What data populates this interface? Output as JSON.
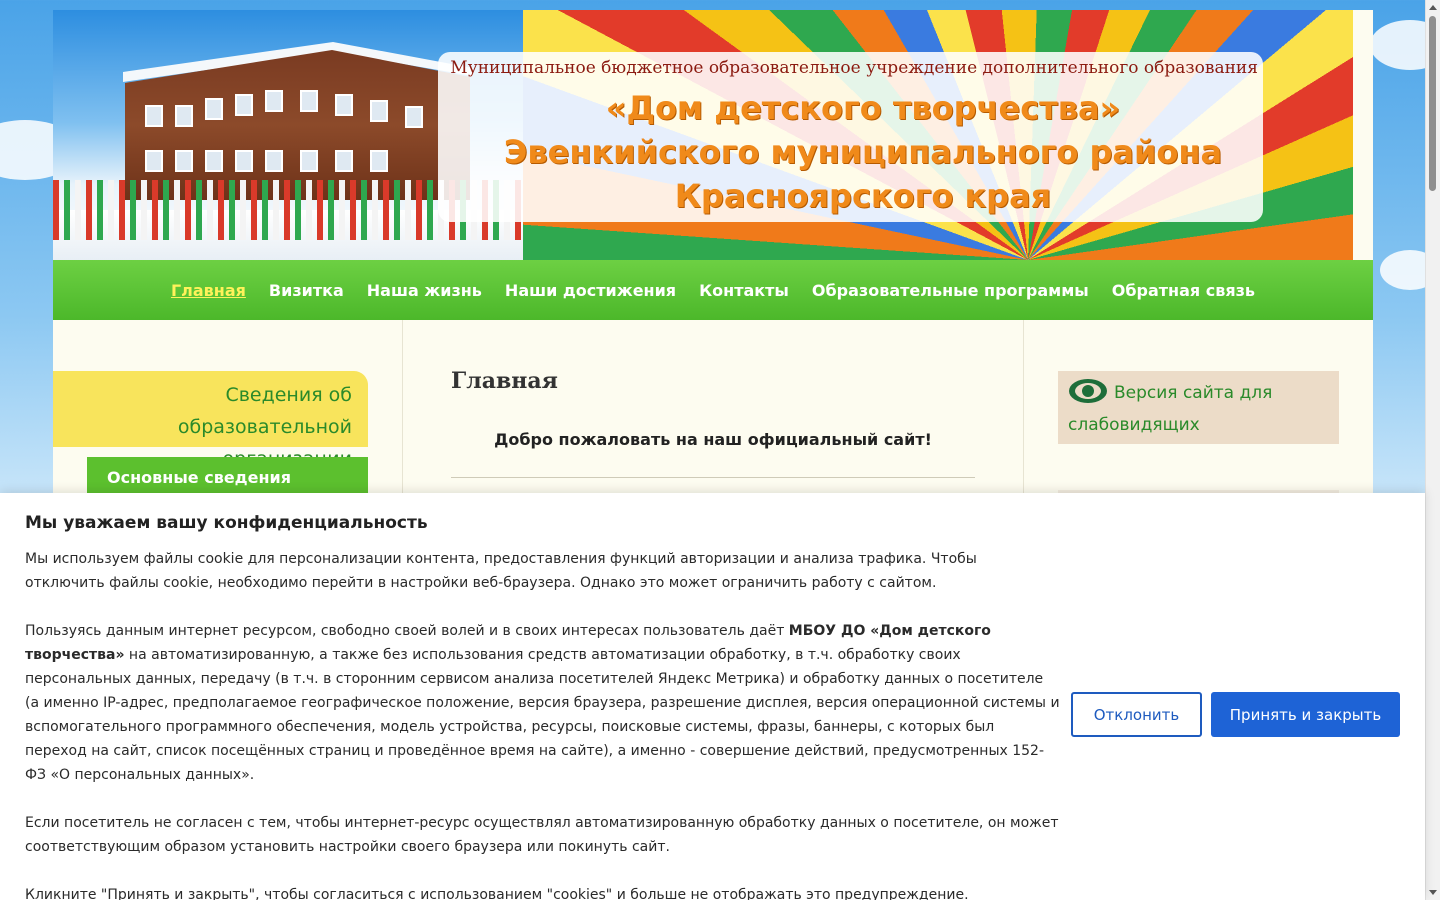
{
  "header": {
    "subtitle": "Муниципальное бюджетное образовательное учреждение дополнительного образования",
    "title_lines": [
      "«Дом детского творчества»",
      "Эвенкийского муниципального района",
      "Красноярского края"
    ]
  },
  "nav": {
    "items": [
      {
        "label": "Главная",
        "active": true
      },
      {
        "label": "Визитка"
      },
      {
        "label": "Наша жизнь"
      },
      {
        "label": "Наши достижения"
      },
      {
        "label": "Контакты"
      },
      {
        "label": "Образовательные программы"
      },
      {
        "label": "Обратная связь"
      }
    ]
  },
  "sidebar_left": {
    "heading": "Сведения об образовательной организации",
    "items": [
      {
        "label": "Основные сведения"
      }
    ]
  },
  "main": {
    "title": "Главная",
    "welcome": "Добро пожаловать на наш официальный сайт!"
  },
  "sidebar_right": {
    "vision_link": "Версия сайта для слабовидящих",
    "vision_icon": "eye-icon"
  },
  "cookie": {
    "title": "Мы уважаем вашу конфиденциальность",
    "p1": "Мы используем файлы cookie для персонализации контента, предоставления функций авторизации и анализа трафика. Чтобы отключить файлы cookie, необходимо перейти в настройки веб-браузера. Однако это может ограничить работу с сайтом.",
    "p2_before": "Пользуясь данным интернет ресурсом, свободно своей волей и в своих интересах пользователь даёт ",
    "p2_bold": "МБОУ ДО «Дом детского творчества»",
    "p2_after": " на автоматизированную, а также без использования средств автоматизации обработку, в т.ч. обработку своих персональных данных, передачу (в т.ч. в сторонним сервисом анализа посетителей Яндекс Метрика) и обработку данных о посетителе (а именно IP-адрес, предполагаемое географическое положение, версия браузера, разрешение дисплея, версия операционной системы и вспомогательного программного обеспечения, модель устройства, ресурсы, поисковые системы, фразы, баннеры, с которых был переход на сайт, список посещённых страниц и проведённое время на сайте), а  именно - совершение действий, предусмотренных 152-ФЗ «О персональных данных».",
    "p3": "Если посетитель не согласен с тем, чтобы интернет-ресурс осуществлял автоматизированную обработку данных о посетителе, он может соответствующим образом установить настройки своего браузера или покинуть сайт.",
    "p4": "Кликните \"Принять и закрыть\", чтобы согласиться с использованием \"cookies\" и больше не отображать это предупреждение.",
    "decline_label": "Отклонить",
    "accept_label": "Принять и закрыть"
  },
  "colors": {
    "nav_green": "#4cb82a",
    "nav_active": "#fff25a",
    "title_orange": "#f08a1a",
    "accept_blue": "#1e63d6"
  }
}
